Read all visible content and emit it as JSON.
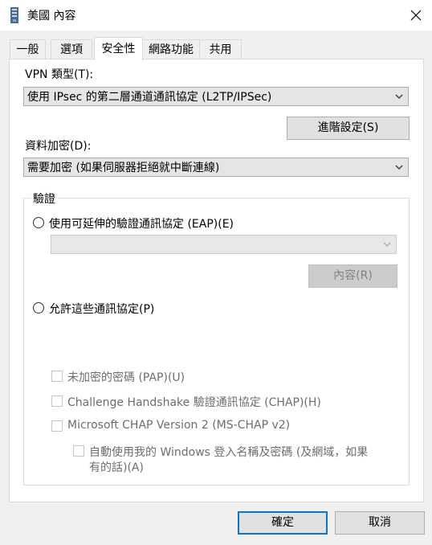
{
  "window": {
    "title": "美國 內容"
  },
  "tabs": [
    {
      "label": "一般"
    },
    {
      "label": "選項"
    },
    {
      "label": "安全性"
    },
    {
      "label": "網路功能"
    },
    {
      "label": "共用"
    }
  ],
  "vpn_type": {
    "label": "VPN 類型(T):",
    "selected": "使用 IPsec 的第二層通道通訊協定 (L2TP/IPSec)"
  },
  "advanced_button": "進階設定(S)",
  "data_encryption": {
    "label": "資料加密(D):",
    "selected": "需要加密 (如果伺服器拒絕就中斷連線)"
  },
  "auth": {
    "group_label": "驗證",
    "eap_radio": "使用可延伸的驗證通訊協定 (EAP)(E)",
    "eap_combo": "",
    "properties_button": "內容(R)",
    "allow_radio": "允許這些通訊協定(P)",
    "checkboxes": [
      "未加密的密碼 (PAP)(U)",
      "Challenge Handshake 驗證通訊協定 (CHAP)(H)",
      "Microsoft CHAP Version 2 (MS-CHAP v2)"
    ],
    "auto_logon_line1": "自動使用我的 Windows 登入名稱及密碼 (及網域，如果",
    "auto_logon_line2": "有的話)(A)"
  },
  "footer": {
    "ok": "確定",
    "cancel": "取消"
  }
}
